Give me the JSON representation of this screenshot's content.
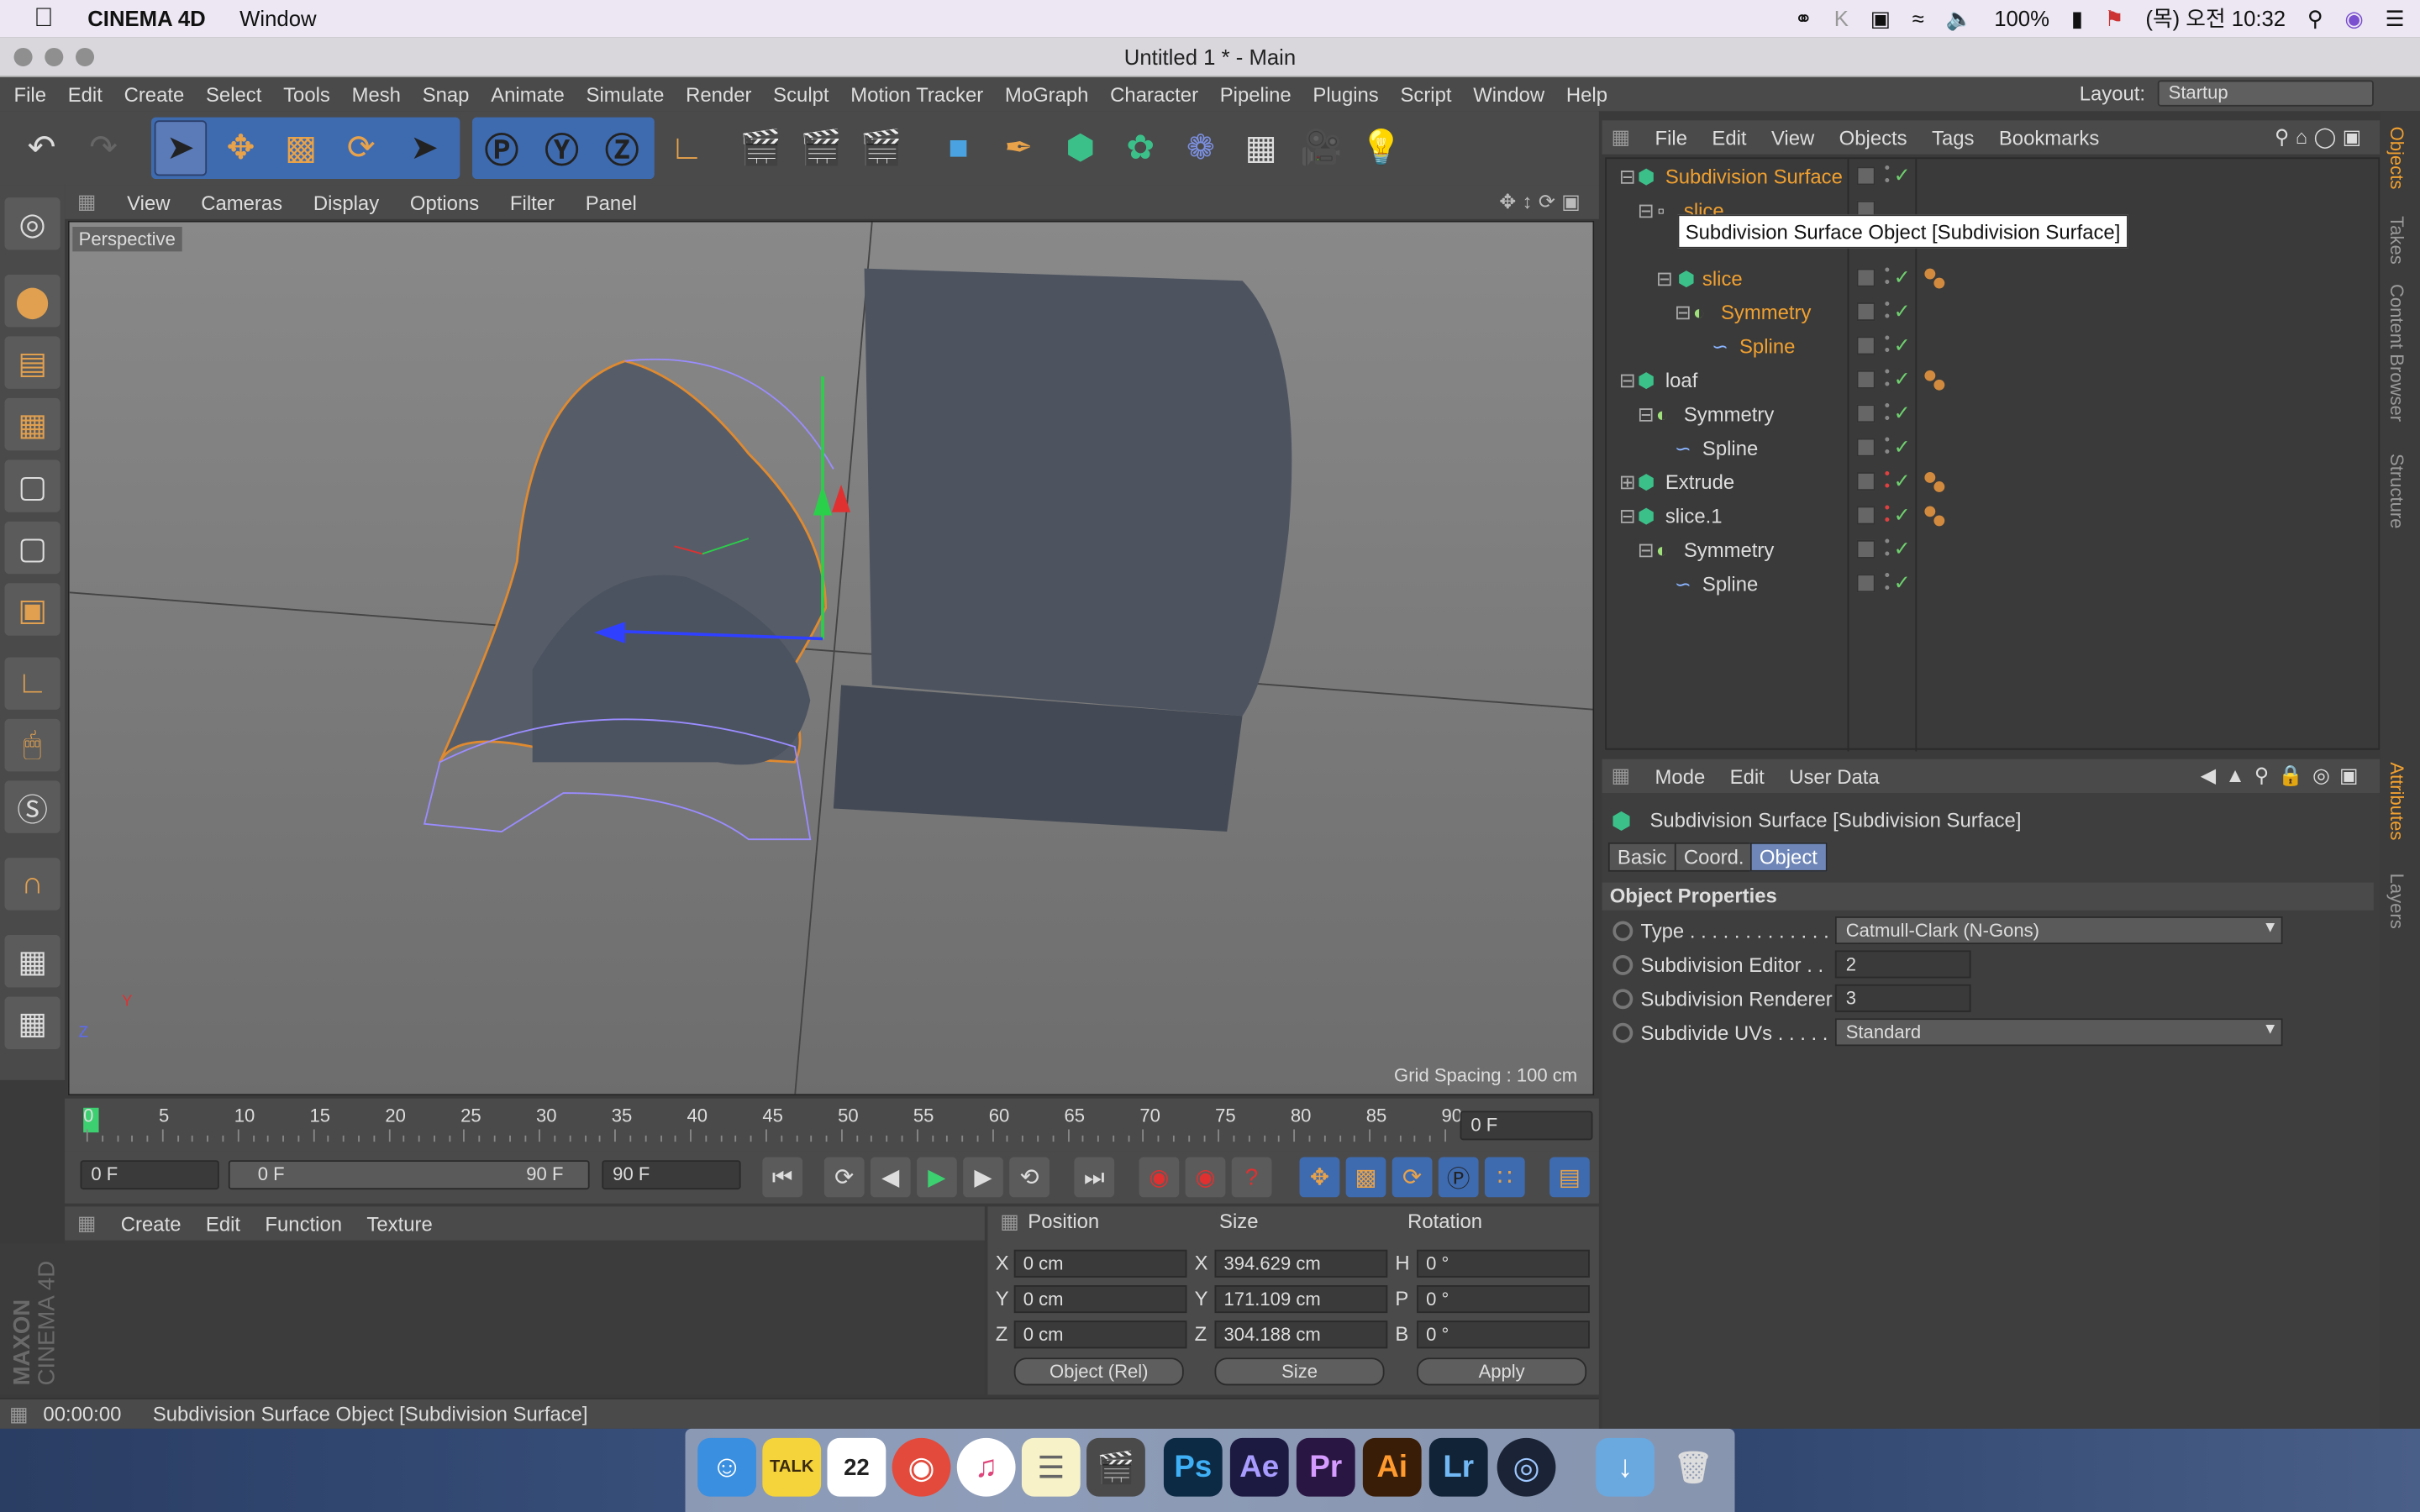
{
  "menubar": {
    "app": "CINEMA 4D",
    "items": [
      "Window"
    ],
    "battery": "100%",
    "clock": "(목) 오전 10:32"
  },
  "title": "Untitled 1 * - Main",
  "c4d_menu": [
    "File",
    "Edit",
    "Create",
    "Select",
    "Tools",
    "Mesh",
    "Snap",
    "Animate",
    "Simulate",
    "Render",
    "Sculpt",
    "Motion Tracker",
    "MoGraph",
    "Character",
    "Pipeline",
    "Plugins",
    "Script",
    "Window",
    "Help"
  ],
  "layout": {
    "label": "Layout:",
    "value": "Startup"
  },
  "viewport": {
    "menu": [
      "View",
      "Cameras",
      "Display",
      "Options",
      "Filter",
      "Panel"
    ],
    "camera": "Perspective",
    "grid_spacing": "Grid Spacing : 100 cm",
    "axis_y": "Y",
    "axis_z": "Z"
  },
  "timeline": {
    "ticks": [
      "0",
      "5",
      "10",
      "15",
      "20",
      "25",
      "30",
      "35",
      "40",
      "45",
      "50",
      "55",
      "60",
      "65",
      "70",
      "75",
      "80",
      "85",
      "90"
    ],
    "current": "0 F",
    "start": "0 F",
    "range_start": "0 F",
    "range_end": "90 F",
    "end": "90 F"
  },
  "materials": {
    "menu": [
      "Create",
      "Edit",
      "Function",
      "Texture"
    ]
  },
  "coords": {
    "headers": [
      "Position",
      "Size",
      "Rotation"
    ],
    "rows": [
      {
        "axis": "X",
        "pos": "0 cm",
        "size_axis": "X",
        "size": "394.629 cm",
        "rot_axis": "H",
        "rot": "0 °"
      },
      {
        "axis": "Y",
        "pos": "0 cm",
        "size_axis": "Y",
        "size": "171.109 cm",
        "rot_axis": "P",
        "rot": "0 °"
      },
      {
        "axis": "Z",
        "pos": "0 cm",
        "size_axis": "Z",
        "size": "304.188 cm",
        "rot_axis": "B",
        "rot": "0 °"
      }
    ],
    "mode": "Object (Rel)",
    "size_mode": "Size",
    "apply": "Apply"
  },
  "status": {
    "time": "00:00:00",
    "text": "Subdivision Surface Object [Subdivision Surface]"
  },
  "objects": {
    "menu": [
      "File",
      "Edit",
      "View",
      "Objects",
      "Tags",
      "Bookmarks"
    ],
    "tooltip": "Subdivision Surface Object [Subdivision Surface]",
    "rows": [
      "Subdivision Surface",
      "slice",
      "slice",
      "Symmetry",
      "Spline",
      "loaf",
      "Symmetry",
      "Spline",
      "Extrude",
      "slice.1",
      "Symmetry",
      "Spline"
    ]
  },
  "attributes": {
    "menu": [
      "Mode",
      "Edit",
      "User Data"
    ],
    "object_title": "Subdivision Surface [Subdivision Surface]",
    "tabs": [
      "Basic",
      "Coord.",
      "Object"
    ],
    "section": "Object Properties",
    "props": [
      {
        "label": "Type . . . . . . . . . . . . . .",
        "value": "Catmull-Clark (N-Gons)"
      },
      {
        "label": "Subdivision Editor  . .",
        "value": "2"
      },
      {
        "label": "Subdivision Renderer",
        "value": "3"
      },
      {
        "label": "Subdivide UVs . . . . .",
        "value": "Standard"
      }
    ]
  },
  "side_tabs": [
    "Objects",
    "Takes",
    "Content Browser",
    "Structure",
    "Attributes",
    "Layers"
  ],
  "maxon": "MAXON",
  "cinema": "CINEMA 4D",
  "dock": {
    "talk": "TALK",
    "cal": "22",
    "ps": "Ps",
    "ae": "Ae",
    "pr": "Pr",
    "ai": "Ai",
    "lr": "Lr"
  },
  "colors": {
    "accent": "#f0a030",
    "selection": "#3e6bb0"
  }
}
